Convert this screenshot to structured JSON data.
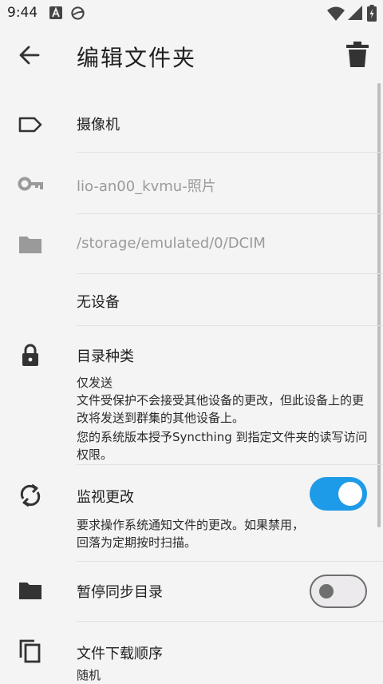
{
  "status_bar": {
    "time": "9:44",
    "icons": [
      "a-notification-icon",
      "sync-icon",
      "wifi-icon",
      "signal-icon",
      "battery-icon"
    ]
  },
  "app_bar": {
    "title": "编辑文件夹",
    "back_icon": "arrow-back-icon",
    "delete_icon": "delete-icon"
  },
  "folder": {
    "label": {
      "value": "摄像机",
      "icon": "label-icon"
    },
    "folder_id": {
      "value": "lio-an00_kvmu-照片",
      "icon": "key-icon"
    },
    "path": {
      "value": "/storage/emulated/0/DCIM",
      "icon": "folder-icon"
    },
    "devices": {
      "value": "无设备"
    },
    "folder_type": {
      "title": "目录种类",
      "value": "仅发送",
      "description_lines": [
        "文件受保护不会接受其他设备的更改，但此设备上的更",
        "改将发送到群集的其他设备上。"
      ],
      "note_lines": [
        "您的系统版本授予Syncthing 到指定文件夹的读写访问",
        "权限。"
      ],
      "icon": "lock-icon"
    },
    "watch_changes": {
      "title": "监视更改",
      "description_lines": [
        "要求操作系统通知文件的更改。如果禁用，",
        "回落为定期按时扫描。"
      ],
      "enabled": true,
      "icon": "sync-refresh-icon"
    },
    "pause_sync": {
      "title": "暂停同步目录",
      "enabled": false,
      "icon": "folder-pause-icon"
    },
    "pull_order": {
      "title": "文件下载顺序",
      "value": "随机",
      "icon": "copy-icon"
    }
  },
  "colors": {
    "accent": "#1e9be8",
    "background": "#f4f4f4",
    "icon": "#3a3a3a",
    "hint": "#9a9a9a"
  }
}
